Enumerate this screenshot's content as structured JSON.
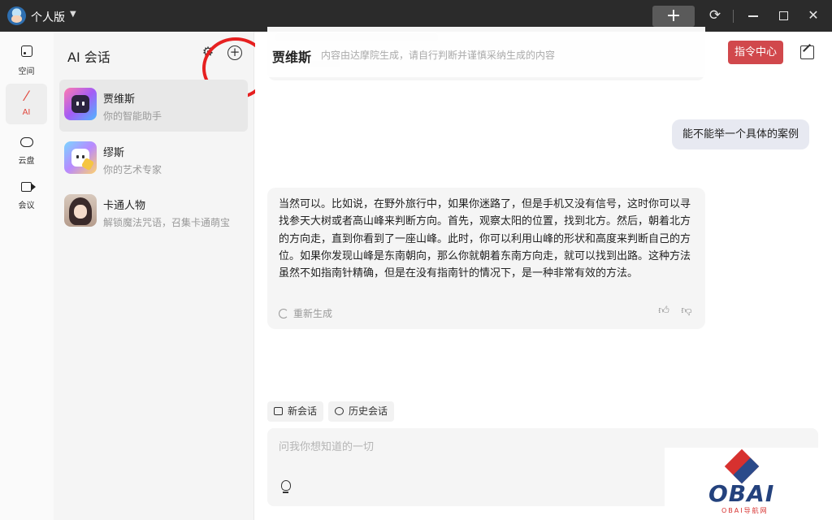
{
  "titlebar": {
    "edition": "个人版",
    "add_label": "+"
  },
  "rail": {
    "items": [
      {
        "label": "空间",
        "icon": "space-icon"
      },
      {
        "label": "AI",
        "icon": "magic-wand-icon"
      },
      {
        "label": "云盘",
        "icon": "cloud-icon"
      },
      {
        "label": "会议",
        "icon": "video-icon"
      }
    ]
  },
  "panel": {
    "title": "AI 会话",
    "sessions": [
      {
        "name": "贾维斯",
        "desc": "你的智能助手"
      },
      {
        "name": "缪斯",
        "desc": "你的艺术专家"
      },
      {
        "name": "卡通人物",
        "desc": "解锁魔法咒语，召集卡通萌宝"
      }
    ]
  },
  "chat": {
    "title": "贾维斯",
    "disclaimer": "内容由达摩院生成，请自行判断并谨慎采纳生成的内容",
    "command_button": "指令中心",
    "user_message": "能不能举一个具体的案例",
    "ai_message": "当然可以。比如说，在野外旅行中，如果你迷路了，但是手机又没有信号，这时你可以寻找参天大树或者高山峰来判断方向。首先，观察太阳的位置，找到北方。然后，朝着北方的方向走，直到你看到了一座山峰。此时，你可以利用山峰的形状和高度来判断自己的方位。如果你发现山峰是东南朝向，那么你就朝着东南方向走，就可以找到出路。这种方法虽然不如指南针精确，但是在没有指南针的情况下，是一种非常有效的方法。",
    "regenerate": "重新生成",
    "new_chat": "新会话",
    "history": "历史会话",
    "input_placeholder": "问我你想知道的一切"
  },
  "watermark": {
    "brand": "OBAI",
    "sub": "OBAI导航网"
  },
  "colors": {
    "titlebar": "#2b2b2b",
    "accent_red": "#d1484c",
    "active_rail": "#e0463c",
    "annotation": "#e62020"
  }
}
